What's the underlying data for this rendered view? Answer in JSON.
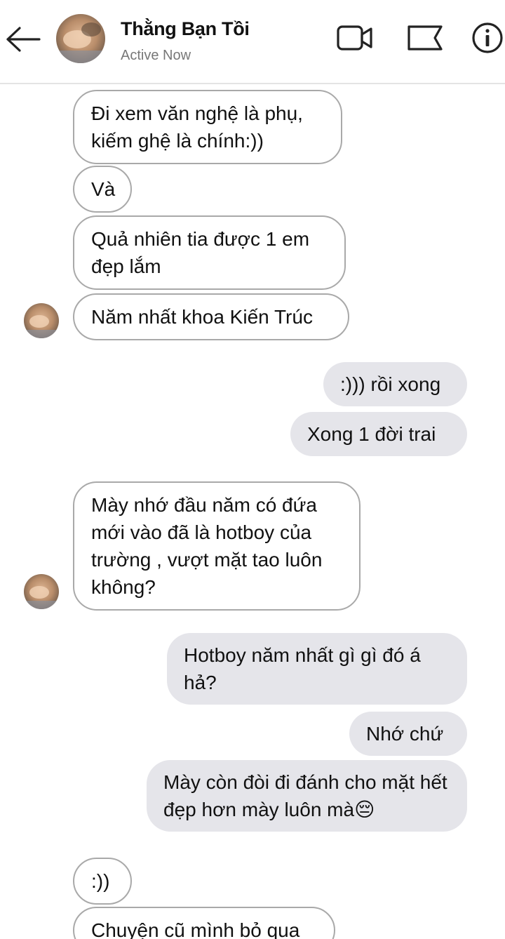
{
  "header": {
    "back_icon": "arrow-left-icon",
    "contact_name": "Thằng Bạn Tồi",
    "status": "Active Now",
    "video_icon": "video-camera-icon",
    "flag_icon": "flag-icon",
    "info_icon": "info-icon"
  },
  "messages": [
    {
      "direction": "in",
      "text": "Đi xem văn nghệ là phụ, kiếm ghệ là chính:))"
    },
    {
      "direction": "in",
      "text": "Và"
    },
    {
      "direction": "in",
      "text": "Quả nhiên tia được 1 em đẹp lắm"
    },
    {
      "direction": "in",
      "text": "Năm nhất khoa Kiến Trúc"
    },
    {
      "direction": "out",
      "text": ":))) rồi xong"
    },
    {
      "direction": "out",
      "text": "Xong 1 đời trai"
    },
    {
      "direction": "in",
      "text": "Mày nhớ đầu năm có đứa mới vào đã là hotboy của trường , vượt mặt tao luôn không?"
    },
    {
      "direction": "out",
      "text": "Hotboy năm nhất gì gì đó á hả?"
    },
    {
      "direction": "out",
      "text": "Nhớ chứ"
    },
    {
      "direction": "out",
      "text": "Mày còn đòi đi đánh cho mặt hết đẹp hơn mày luôn mà😔"
    },
    {
      "direction": "in",
      "text": ":))"
    },
    {
      "direction": "in",
      "text": "Chuyện cũ mình bỏ qua"
    }
  ],
  "colors": {
    "incoming_border": "#a9a9a9",
    "outgoing_bg": "#e5e5ea",
    "status_text": "#777777"
  }
}
